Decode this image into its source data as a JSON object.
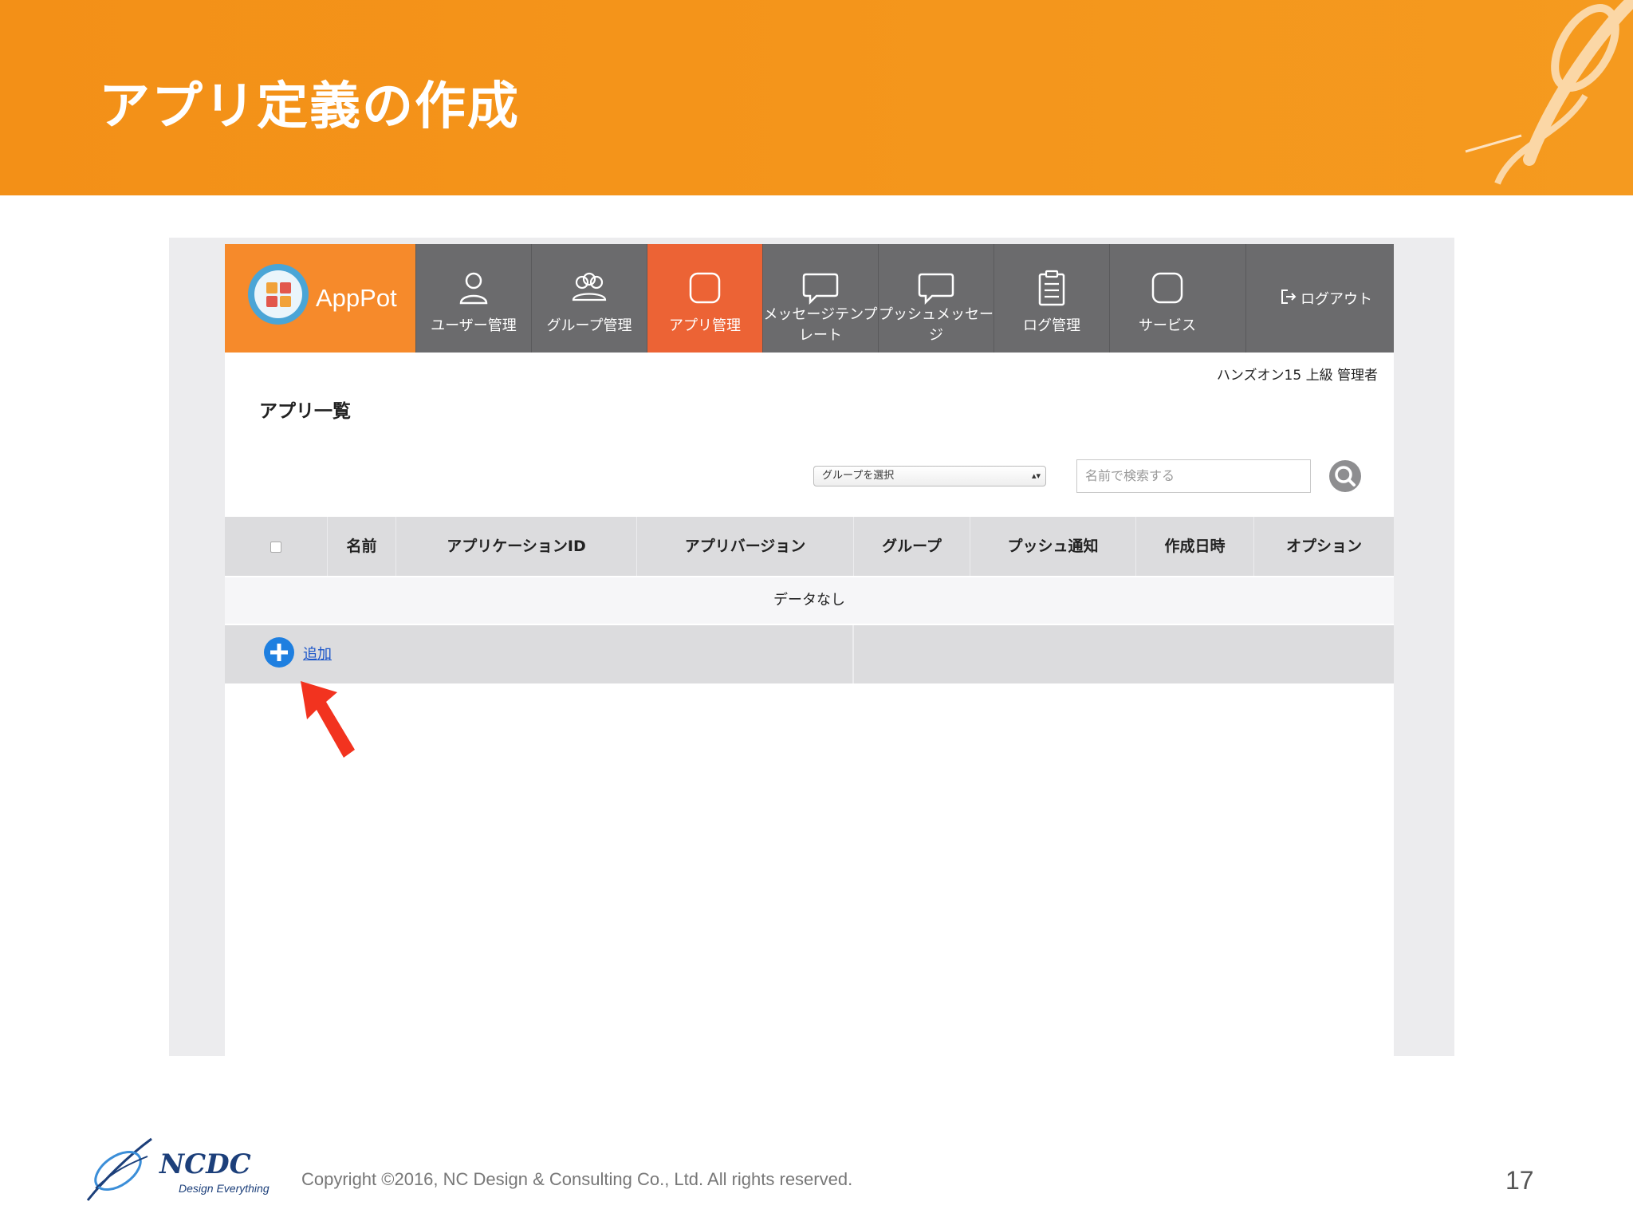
{
  "slide": {
    "title": "アプリ定義の作成",
    "copyright": "Copyright ©2016, NC Design & Consulting Co., Ltd. All rights reserved.",
    "page_number": "17",
    "logo": {
      "name": "NCDC",
      "tagline": "Design Everything"
    },
    "header_color": "#f39017"
  },
  "app": {
    "brand": "AppPot",
    "nav": [
      {
        "label": "ユーザー管理",
        "icon": "user-icon",
        "active": false
      },
      {
        "label": "グループ管理",
        "icon": "group-icon",
        "active": false
      },
      {
        "label": "アプリ管理",
        "icon": "app-icon",
        "active": true
      },
      {
        "label": "メッセージテンプレート",
        "icon": "message-icon",
        "active": false
      },
      {
        "label": "プッシュメッセージ",
        "icon": "message-icon",
        "active": false
      },
      {
        "label": "ログ管理",
        "icon": "clipboard-icon",
        "active": false
      },
      {
        "label": "サービス",
        "icon": "service-icon",
        "active": false
      }
    ],
    "logout_label": "ログアウト",
    "user_line": "ハンズオン15 上級 管理者",
    "page_heading": "アプリ一覧",
    "group_select": {
      "value": "グループを選択"
    },
    "search": {
      "placeholder": "名前で検索する"
    },
    "table": {
      "columns": [
        "名前",
        "アプリケーションID",
        "アプリバージョン",
        "グループ",
        "プッシュ通知",
        "作成日時",
        "オプション"
      ],
      "empty_text": "データなし",
      "add_label": "追加"
    },
    "colors": {
      "nav_bg": "#6b6b6d",
      "brand_bg": "#f68a2b",
      "active_bg": "#ec6335",
      "link": "#1a55c9"
    }
  }
}
